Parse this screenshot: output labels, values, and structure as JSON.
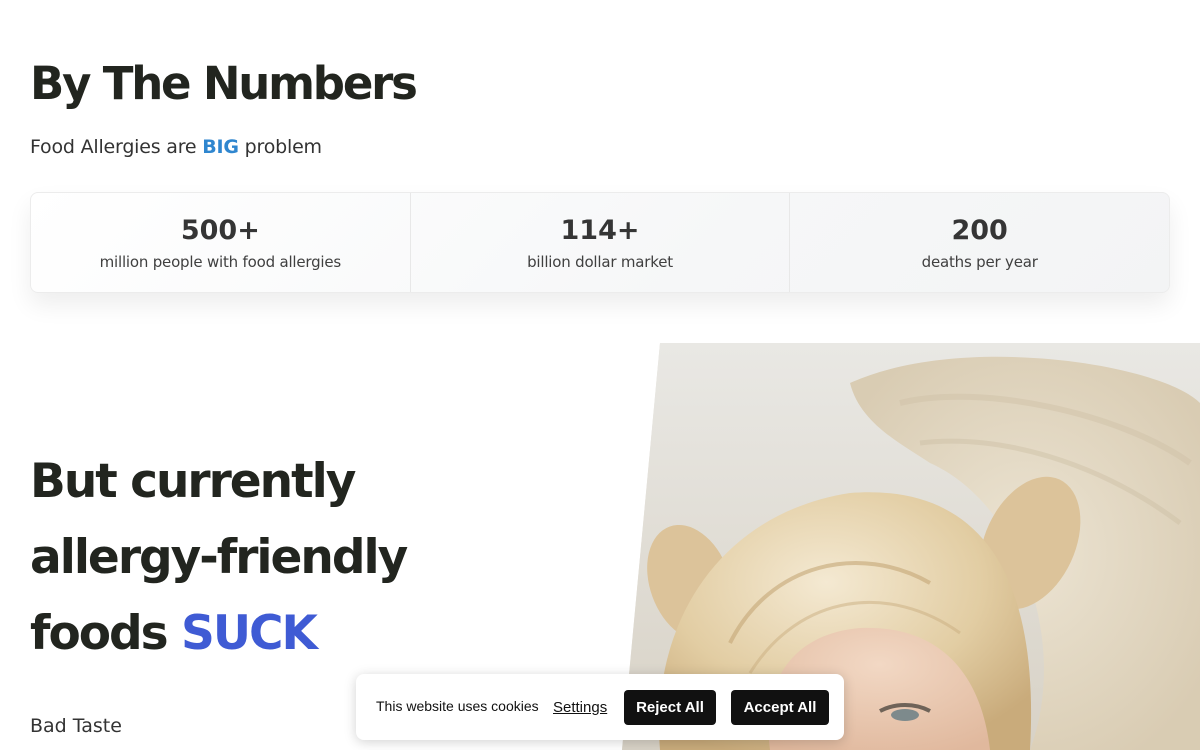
{
  "numbers": {
    "title": "By The Numbers",
    "subtitle_before": "Food Allergies are ",
    "subtitle_highlight": "BIG",
    "subtitle_after": " problem",
    "stats": [
      {
        "value": "500+",
        "label": "million people with food allergies"
      },
      {
        "value": "114+",
        "label": "billion dollar market"
      },
      {
        "value": "200",
        "label": "deaths per year"
      }
    ]
  },
  "hero": {
    "line1": "But currently",
    "line2": "allergy-friendly",
    "line3_before": "foods ",
    "line3_highlight": "SUCK"
  },
  "problems": {
    "item1": "Bad Taste"
  },
  "cookie": {
    "text": "This website uses cookies",
    "settings": "Settings",
    "reject": "Reject All",
    "accept": "Accept All"
  },
  "colors": {
    "highlight_blue": "#2f86cf",
    "suck_blue": "#3f5bd4",
    "button_dark": "#111111"
  }
}
